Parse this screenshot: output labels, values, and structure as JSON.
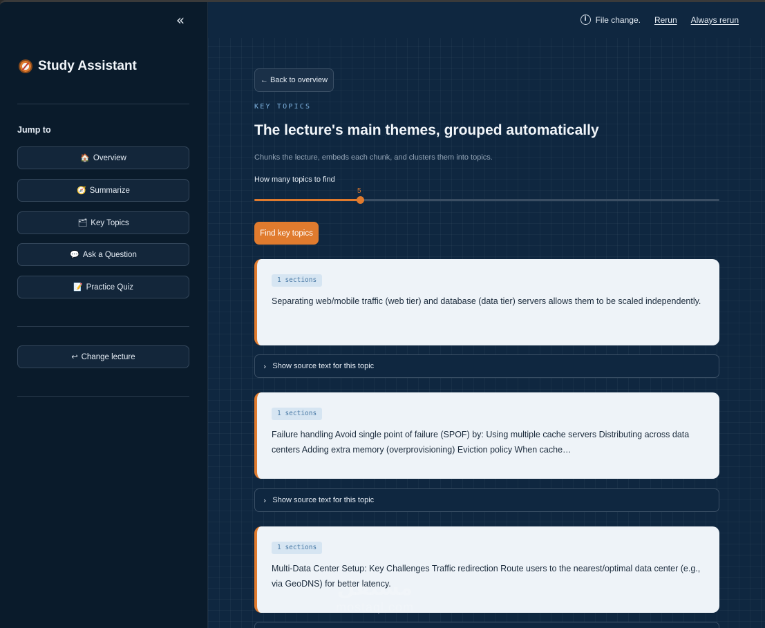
{
  "sidebar": {
    "collapse_glyph": "«",
    "brand_title": "Study Assistant",
    "jump_label": "Jump to",
    "items": [
      {
        "icon": "🏠",
        "label": "Overview"
      },
      {
        "icon": "🧭",
        "label": "Summarize"
      },
      {
        "icon": "🗂",
        "label": "Key Topics"
      },
      {
        "icon": "💬",
        "label": "Ask a Question"
      },
      {
        "icon": "📝",
        "label": "Practice Quiz"
      }
    ],
    "change_lecture": {
      "icon": "↩",
      "label": "Change lecture"
    }
  },
  "topbar": {
    "status": "File change.",
    "rerun": "Rerun",
    "always_rerun": "Always rerun"
  },
  "main": {
    "back_label": "← Back to overview",
    "eyebrow": "KEY TOPICS",
    "heading": "The lecture's main themes, grouped automatically",
    "subtext": "Chunks the lecture, embeds each chunk, and clusters them into topics.",
    "slider": {
      "label": "How many topics to find",
      "value": "5",
      "fraction": 0.227
    },
    "action_label": "Find key topics",
    "expander_label": "Show source text for this topic",
    "topics": [
      {
        "badge": "1 sections",
        "text": "Separating web/mobile traffic (web tier) and database (data tier) servers allows them to be scaled independently."
      },
      {
        "badge": "1 sections",
        "text": "Failure handling Avoid single point of failure (SPOF) by: Using multiple cache servers Distributing across data centers Adding extra memory (overprovisioning) Eviction policy When cache…"
      },
      {
        "badge": "1 sections",
        "text": "Multi-Data Center Setup: Key Challenges Traffic redirection Route users to the nearest/optimal data center (e.g., via GeoDNS) for better latency."
      }
    ]
  },
  "watermark": {
    "logo": "مستقل",
    "text": "mostaql.com"
  },
  "colors": {
    "accent": "#e07b2e",
    "sidebar_bg": "#0a1b2b",
    "main_bg": "#0f2740",
    "card_bg": "#eef3f8"
  }
}
